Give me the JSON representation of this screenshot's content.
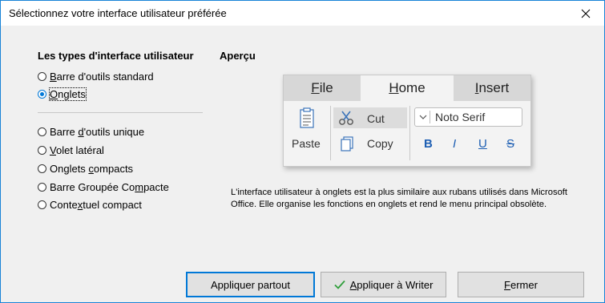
{
  "dialog": {
    "title": "Sélectionnez votre interface utilisateur préférée",
    "close_glyph": "✕"
  },
  "left": {
    "heading": "Les types d'interface utilisateur",
    "options": [
      {
        "pre": "",
        "u": "B",
        "post": "arre d'outils standard",
        "checked": false
      },
      {
        "pre": "",
        "u": "O",
        "post": "nglets",
        "checked": true
      },
      {
        "pre": "Barre ",
        "u": "d",
        "post": "'outils unique",
        "checked": false
      },
      {
        "pre": "",
        "u": "V",
        "post": "olet latéral",
        "checked": false
      },
      {
        "pre": "Onglets ",
        "u": "c",
        "post": "ompacts",
        "checked": false
      },
      {
        "pre": "Barre Groupée Co",
        "u": "m",
        "post": "pacte",
        "checked": false
      },
      {
        "pre": "Conte",
        "u": "x",
        "post": "tuel compact",
        "checked": false
      }
    ]
  },
  "preview": {
    "heading": "Aperçu",
    "tabs": [
      {
        "u": "F",
        "rest": "ile"
      },
      {
        "u": "H",
        "rest": "ome"
      },
      {
        "u": "I",
        "rest": "nsert"
      }
    ],
    "paste_label": "Paste",
    "cut_label": "Cut",
    "copy_label": "Copy",
    "font_name": "Noto Serif",
    "bold": "B",
    "italic": "I",
    "underline": "U",
    "strike": "S",
    "description": "L'interface utilisateur à onglets est la plus similaire aux rubans utilisés dans Microsoft Office. Elle organise les fonctions en onglets et rend le menu principal obsolète."
  },
  "buttons": {
    "apply_all": "Appliquer partout",
    "apply_writer_u": "A",
    "apply_writer_rest": "ppliquer à Writer",
    "close_u": "F",
    "close_rest": "ermer"
  },
  "colors": {
    "accent": "#0078d7",
    "check": "#2e9e3a",
    "format_blue": "#1e5fb3"
  }
}
